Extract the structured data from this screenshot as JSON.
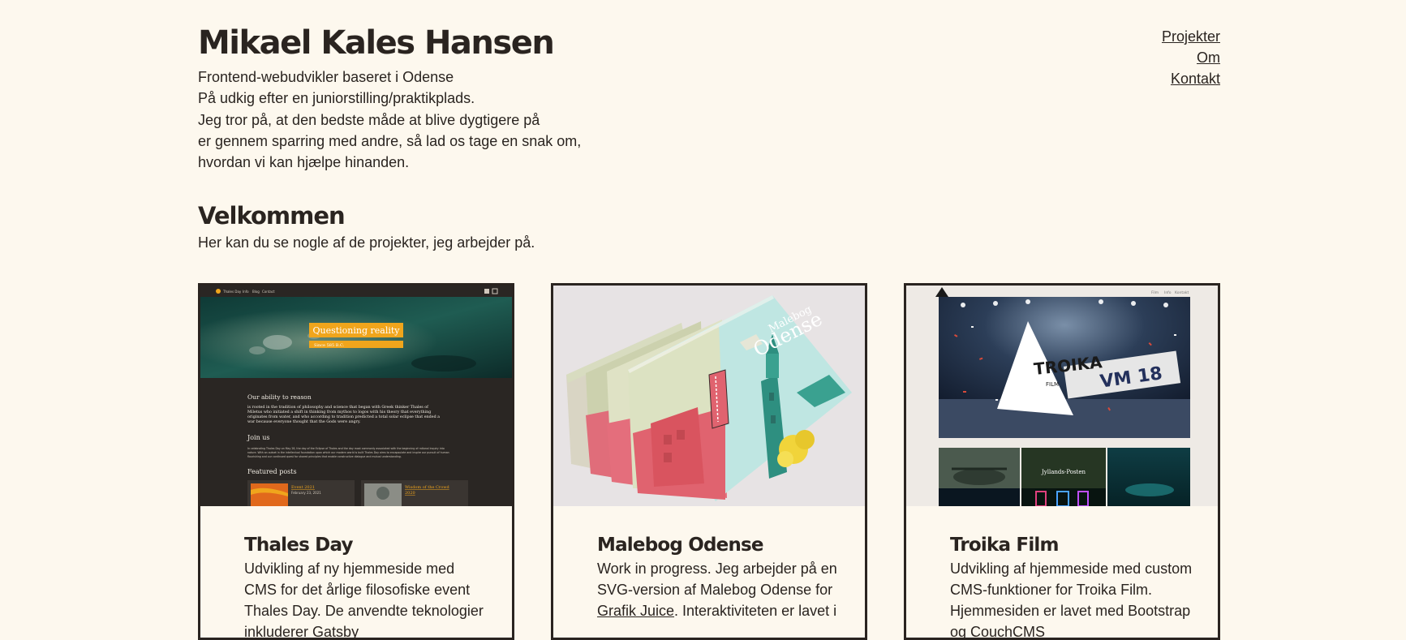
{
  "header": {
    "name": "Mikael Kales Hansen",
    "intro_lines": [
      "Frontend-webudvikler baseret i Odense",
      "På udkig efter en juniorstilling/praktikplads.",
      "Jeg tror på, at den bedste måde at blive dygtigere på",
      "er gennem sparring med andre, så lad os tage en snak om,",
      "hvordan vi kan hjælpe hinanden."
    ]
  },
  "nav": {
    "projects": "Projekter",
    "about": "Om",
    "contact": "Kontakt"
  },
  "welcome": {
    "title": "Velkommen",
    "text": "Her kan du se nogle af de projekter, jeg arbejder på."
  },
  "projects": [
    {
      "title": "Thales Day",
      "desc": "Udvikling af ny hjemmeside med CMS for det årlige filosofiske event Thales Day. De anvendte teknologier inkluderer Gatsby",
      "thumb": {
        "nav_logo": "Thales Day",
        "nav": [
          "Info",
          "Blog",
          "Contact"
        ],
        "hero_title": "Questioning reality",
        "hero_sub": "Since 585 B.C.",
        "section1_title": "Our ability to reason",
        "section1_text": [
          "is rooted in the tradition of philosophy and science that began with Greek thinker Thales of",
          "Miletus who initiated a shift in thinking from mythos to logos with his theory that everything",
          "originates from water, and who according to tradition predicted a total solar eclipse that ended a",
          "war because everyone thought that the Gods were angry."
        ],
        "section2_title": "Join us",
        "section2_text": [
          "In celebrating Thales Day on May 28, the day of the Eclipse of Thales and the day most commonly associated with the beginning of rational inquiry into",
          "nature. With an outset in the intellectual foundation upon which our modern world is built Thales Day aims to encapsulate and inspire our pursuit of human",
          "flourishing and our continued quest for shared principles that enable constructive dialogue and mutual understanding."
        ],
        "featured_title": "Featured posts",
        "post1_title": "Event 2021",
        "post1_date": "February 23, 2021",
        "post2_title": "Wisdom of the Crowd",
        "post2_sub": "2020"
      }
    },
    {
      "title": "Malebog Odense",
      "desc_before": "Work in progress. Jeg arbejder på en SVG-version af Malebog Odense for ",
      "desc_link": "Grafik Juice",
      "desc_after": ". Interaktiviteten er lavet i",
      "thumb": {
        "book_title": "Odense",
        "book_subtitle": "Malebog"
      }
    },
    {
      "title": "Troika Film",
      "desc": "Udvikling af hjemmeside med custom CMS-funktioner for Troika Film. Hjemmesiden er lavet med Bootstrap og CouchCMS",
      "thumb": {
        "nav": [
          "Film",
          "Info",
          "Kontakt"
        ],
        "logo_main": "TROIKA",
        "logo_sub": "FILM",
        "banner_text": "VM 18",
        "tile_label": "Jyllands-Posten"
      }
    }
  ],
  "colors": {
    "background": "#fdf8ee",
    "text": "#2a2420",
    "accent": "#f0a51c"
  }
}
